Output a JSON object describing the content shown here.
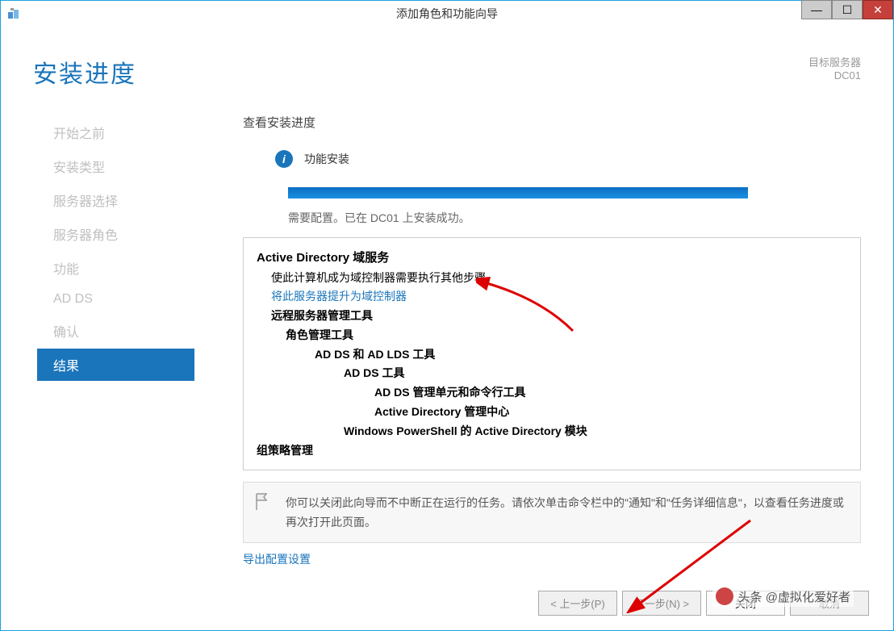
{
  "titlebar": {
    "title": "添加角色和功能向导"
  },
  "page": {
    "title": "安装进度"
  },
  "target": {
    "label": "目标服务器",
    "name": "DC01"
  },
  "sidebar": {
    "items": [
      {
        "label": "开始之前"
      },
      {
        "label": "安装类型"
      },
      {
        "label": "服务器选择"
      },
      {
        "label": "服务器角色"
      },
      {
        "label": "功能"
      },
      {
        "label": "AD DS"
      },
      {
        "label": "确认"
      },
      {
        "label": "结果"
      }
    ]
  },
  "main": {
    "viewTitle": "查看安装进度",
    "infoLabel": "功能安装",
    "statusLine": "需要配置。已在 DC01 上安装成功。"
  },
  "results": {
    "heading": "Active Directory 域服务",
    "subtext": "使此计算机成为域控制器需要执行其他步骤。",
    "link": "将此服务器提升为域控制器",
    "remoteTools": "远程服务器管理工具",
    "roleTools": "角色管理工具",
    "addsAdlds": "AD DS 和 AD LDS 工具",
    "addsTools": "AD DS 工具",
    "addsSnapins": "AD DS 管理单元和命令行工具",
    "adAdminCenter": "Active Directory 管理中心",
    "psModule": "Windows PowerShell 的 Active Directory 模块",
    "gpm": "组策略管理"
  },
  "note": {
    "text": "你可以关闭此向导而不中断正在运行的任务。请依次单击命令栏中的\"通知\"和\"任务详细信息\"，以查看任务进度或再次打开此页面。"
  },
  "exportLink": "导出配置设置",
  "footer": {
    "prev": "< 上一步(P)",
    "next": "下一步(N) >",
    "close": "关闭",
    "cancel": "取消"
  },
  "watermark": "头条 @虚拟化爱好者"
}
